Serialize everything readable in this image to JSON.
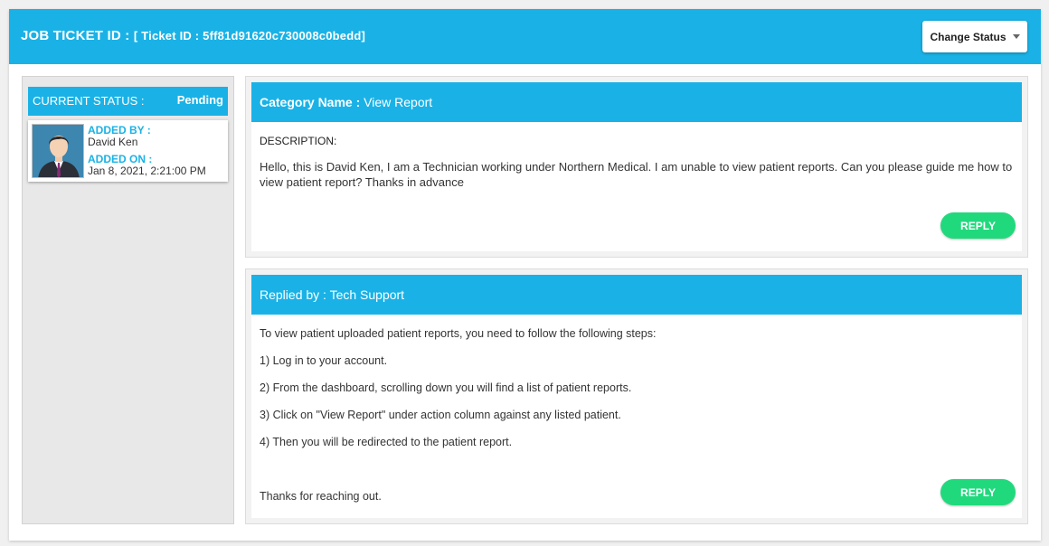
{
  "header": {
    "title": "JOB TICKET ID :",
    "ticket": "[ Ticket ID : 5ff81d91620c730008c0bedd]",
    "change_status": "Change Status"
  },
  "status": {
    "label": "CURRENT STATUS :",
    "value": "Pending",
    "added_by_label": "ADDED BY :",
    "added_by": "David Ken",
    "added_on_label": "ADDED ON :",
    "added_on": "Jan 8, 2021, 2:21:00 PM"
  },
  "ticket": {
    "category_label": "Category Name :",
    "category": "View Report",
    "description_label": "DESCRIPTION:",
    "description": "Hello, this is David Ken, I am a Technician working under Northern Medical. I am unable to view patient reports. Can you please guide me how to view patient report? Thanks in advance",
    "reply_label": "REPLY"
  },
  "reply": {
    "replied_by": "Replied by : Tech Support",
    "lines": [
      "To view patient uploaded patient reports, you need to follow the following steps:",
      "1) Log in to your account.",
      "2) From the dashboard, scrolling down you will find a list of patient reports.",
      "3) Click on \"View Report\" under action column against any listed patient.",
      "4) Then you will be redirected to the patient report."
    ],
    "closing": "Thanks for reaching out.",
    "reply_label": "REPLY"
  },
  "colors": {
    "accent": "#1ab2e6",
    "reply_button": "#21d97d"
  }
}
